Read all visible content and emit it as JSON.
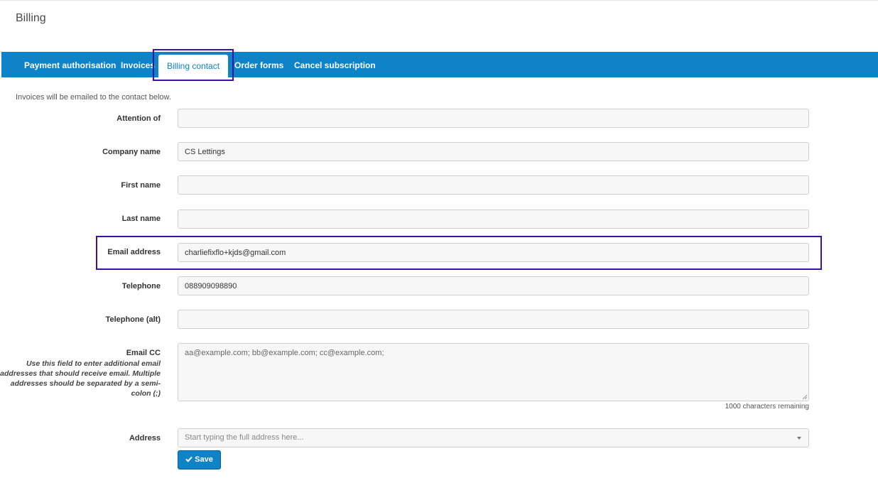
{
  "page": {
    "title": "Billing"
  },
  "tabs": [
    {
      "label": "Payment authorisation"
    },
    {
      "label": "Invoices"
    },
    {
      "label": "Billing contact",
      "active": true
    },
    {
      "label": "Order forms"
    },
    {
      "label": "Cancel subscription"
    }
  ],
  "intro": "Invoices will be emailed to the contact below.",
  "form": {
    "attention_of": {
      "label": "Attention of",
      "value": ""
    },
    "company_name": {
      "label": "Company name",
      "value": "CS Lettings"
    },
    "first_name": {
      "label": "First name",
      "value": ""
    },
    "last_name": {
      "label": "Last name",
      "value": ""
    },
    "email_address": {
      "label": "Email address",
      "value": "charliefixflo+kjds@gmail.com"
    },
    "telephone": {
      "label": "Telephone",
      "value": "088909098890"
    },
    "telephone_alt": {
      "label": "Telephone (alt)",
      "value": ""
    },
    "email_cc": {
      "label": "Email CC",
      "help": "Use this field to enter additional email addresses that should receive email. Multiple addresses should be separated by a semi-colon (;)",
      "value": "",
      "placeholder": "aa@example.com; bb@example.com; cc@example.com;",
      "chars_remaining": "1000 characters remaining"
    },
    "address": {
      "label": "Address",
      "placeholder": "Start typing the full address here..."
    },
    "save_label": "Save"
  },
  "icons": {
    "save": "check-icon",
    "dropdown": "chevron-down-icon",
    "resize": "resize-grip-icon"
  },
  "colors": {
    "brand": "#0e83c7",
    "highlight": "#3b13a3"
  }
}
